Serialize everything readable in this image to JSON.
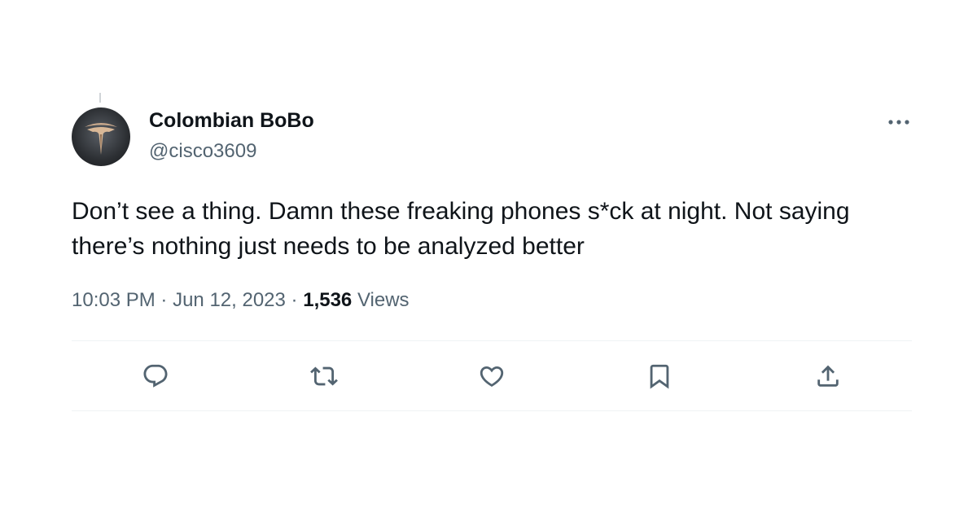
{
  "tweet": {
    "display_name": "Colombian BoBo",
    "handle": "@cisco3609",
    "text": "Don’t see a thing. Damn these freaking phones s*ck at night. Not saying there’s nothing just needs to be analyzed better",
    "time": "10:03 PM",
    "date": "Jun 12, 2023",
    "separator": "·",
    "views_count": "1,536",
    "views_label": "Views"
  },
  "icons": {
    "avatar": "tesla-logo-avatar",
    "more": "more-icon",
    "reply": "reply-icon",
    "retweet": "retweet-icon",
    "like": "like-icon",
    "bookmark": "bookmark-icon",
    "share": "share-icon"
  },
  "colors": {
    "text_primary": "#0f1419",
    "text_secondary": "#536471",
    "divider": "#eff3f4",
    "background": "#ffffff"
  }
}
